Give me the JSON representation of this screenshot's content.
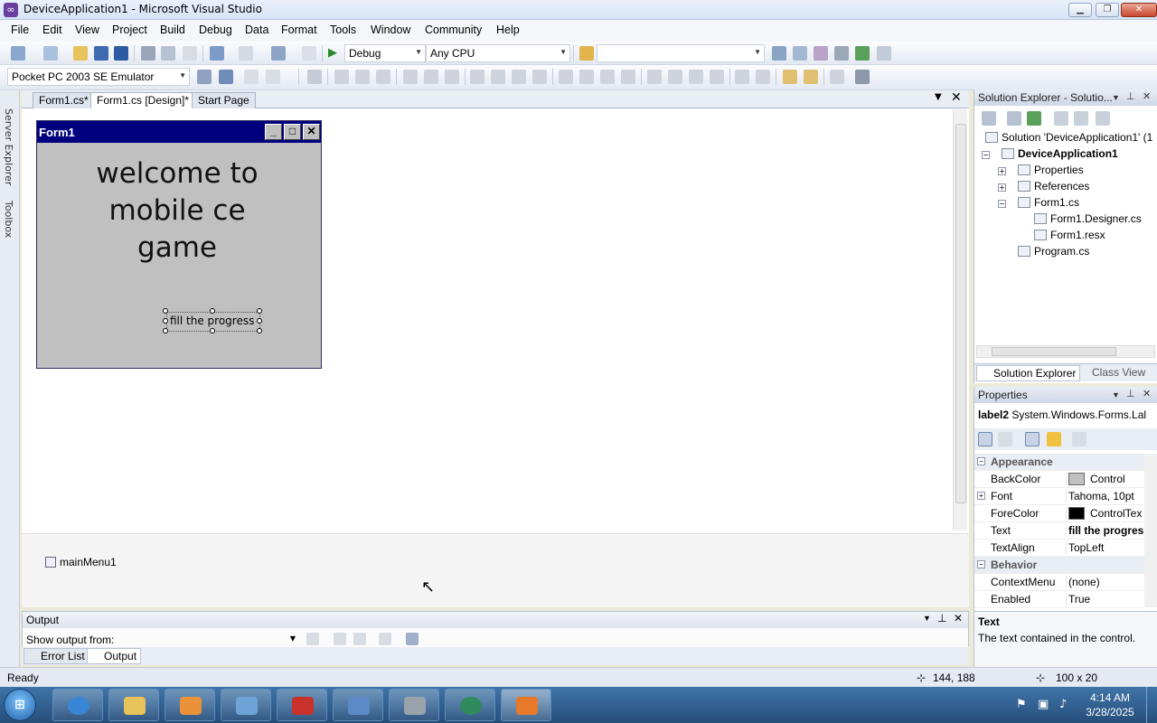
{
  "window": {
    "title": "DeviceApplication1 - Microsoft Visual Studio"
  },
  "menu": [
    "File",
    "Edit",
    "View",
    "Project",
    "Build",
    "Debug",
    "Data",
    "Format",
    "Tools",
    "Window",
    "Community",
    "Help"
  ],
  "toolbar": {
    "config": "Debug",
    "platform": "Any CPU",
    "device": "Pocket PC 2003 SE Emulator"
  },
  "side_rail": {
    "server_explorer": "Server Explorer",
    "toolbox": "Toolbox"
  },
  "doc_tabs": [
    {
      "label": "Form1.cs*"
    },
    {
      "label": "Form1.cs [Design]*"
    },
    {
      "label": "Start Page"
    }
  ],
  "form": {
    "caption": "Form1",
    "welcome_text": "welcome to mobile ce game",
    "label2_text": "fill  the progress"
  },
  "tray": {
    "item": "mainMenu1"
  },
  "output": {
    "title": "Output",
    "show_from": "Show output from:",
    "tabs": [
      "Error List",
      "Output"
    ]
  },
  "solution_explorer": {
    "title": "Solution Explorer - Solutio...",
    "items": [
      "Solution 'DeviceApplication1' (1",
      "DeviceApplication1",
      "Properties",
      "References",
      "Form1.cs",
      "Form1.Designer.cs",
      "Form1.resx",
      "Program.cs"
    ],
    "tabs": [
      "Solution Explorer",
      "Class View"
    ]
  },
  "properties": {
    "title": "Properties",
    "object": "label2",
    "object_type": "System.Windows.Forms.Lal",
    "rows": [
      {
        "name": "Appearance",
        "category": true
      },
      {
        "name": "BackColor",
        "value": "Control",
        "swatch": "#c0c0c0"
      },
      {
        "name": "Font",
        "value": "Tahoma, 10pt",
        "expandable": true
      },
      {
        "name": "ForeColor",
        "value": "ControlTex",
        "swatch": "#000000"
      },
      {
        "name": "Text",
        "value": "fill the progres",
        "bold": true
      },
      {
        "name": "TextAlign",
        "value": "TopLeft"
      },
      {
        "name": "Behavior",
        "category": true
      },
      {
        "name": "ContextMenu",
        "value": "(none)"
      },
      {
        "name": "Enabled",
        "value": "True"
      }
    ],
    "desc_title": "Text",
    "desc_text": "The text contained in the control."
  },
  "statusbar": {
    "text": "Ready",
    "position": "144, 188",
    "size": "100 x 20"
  },
  "taskbar": {
    "time": "4:14 AM",
    "date": "3/28/2025"
  }
}
